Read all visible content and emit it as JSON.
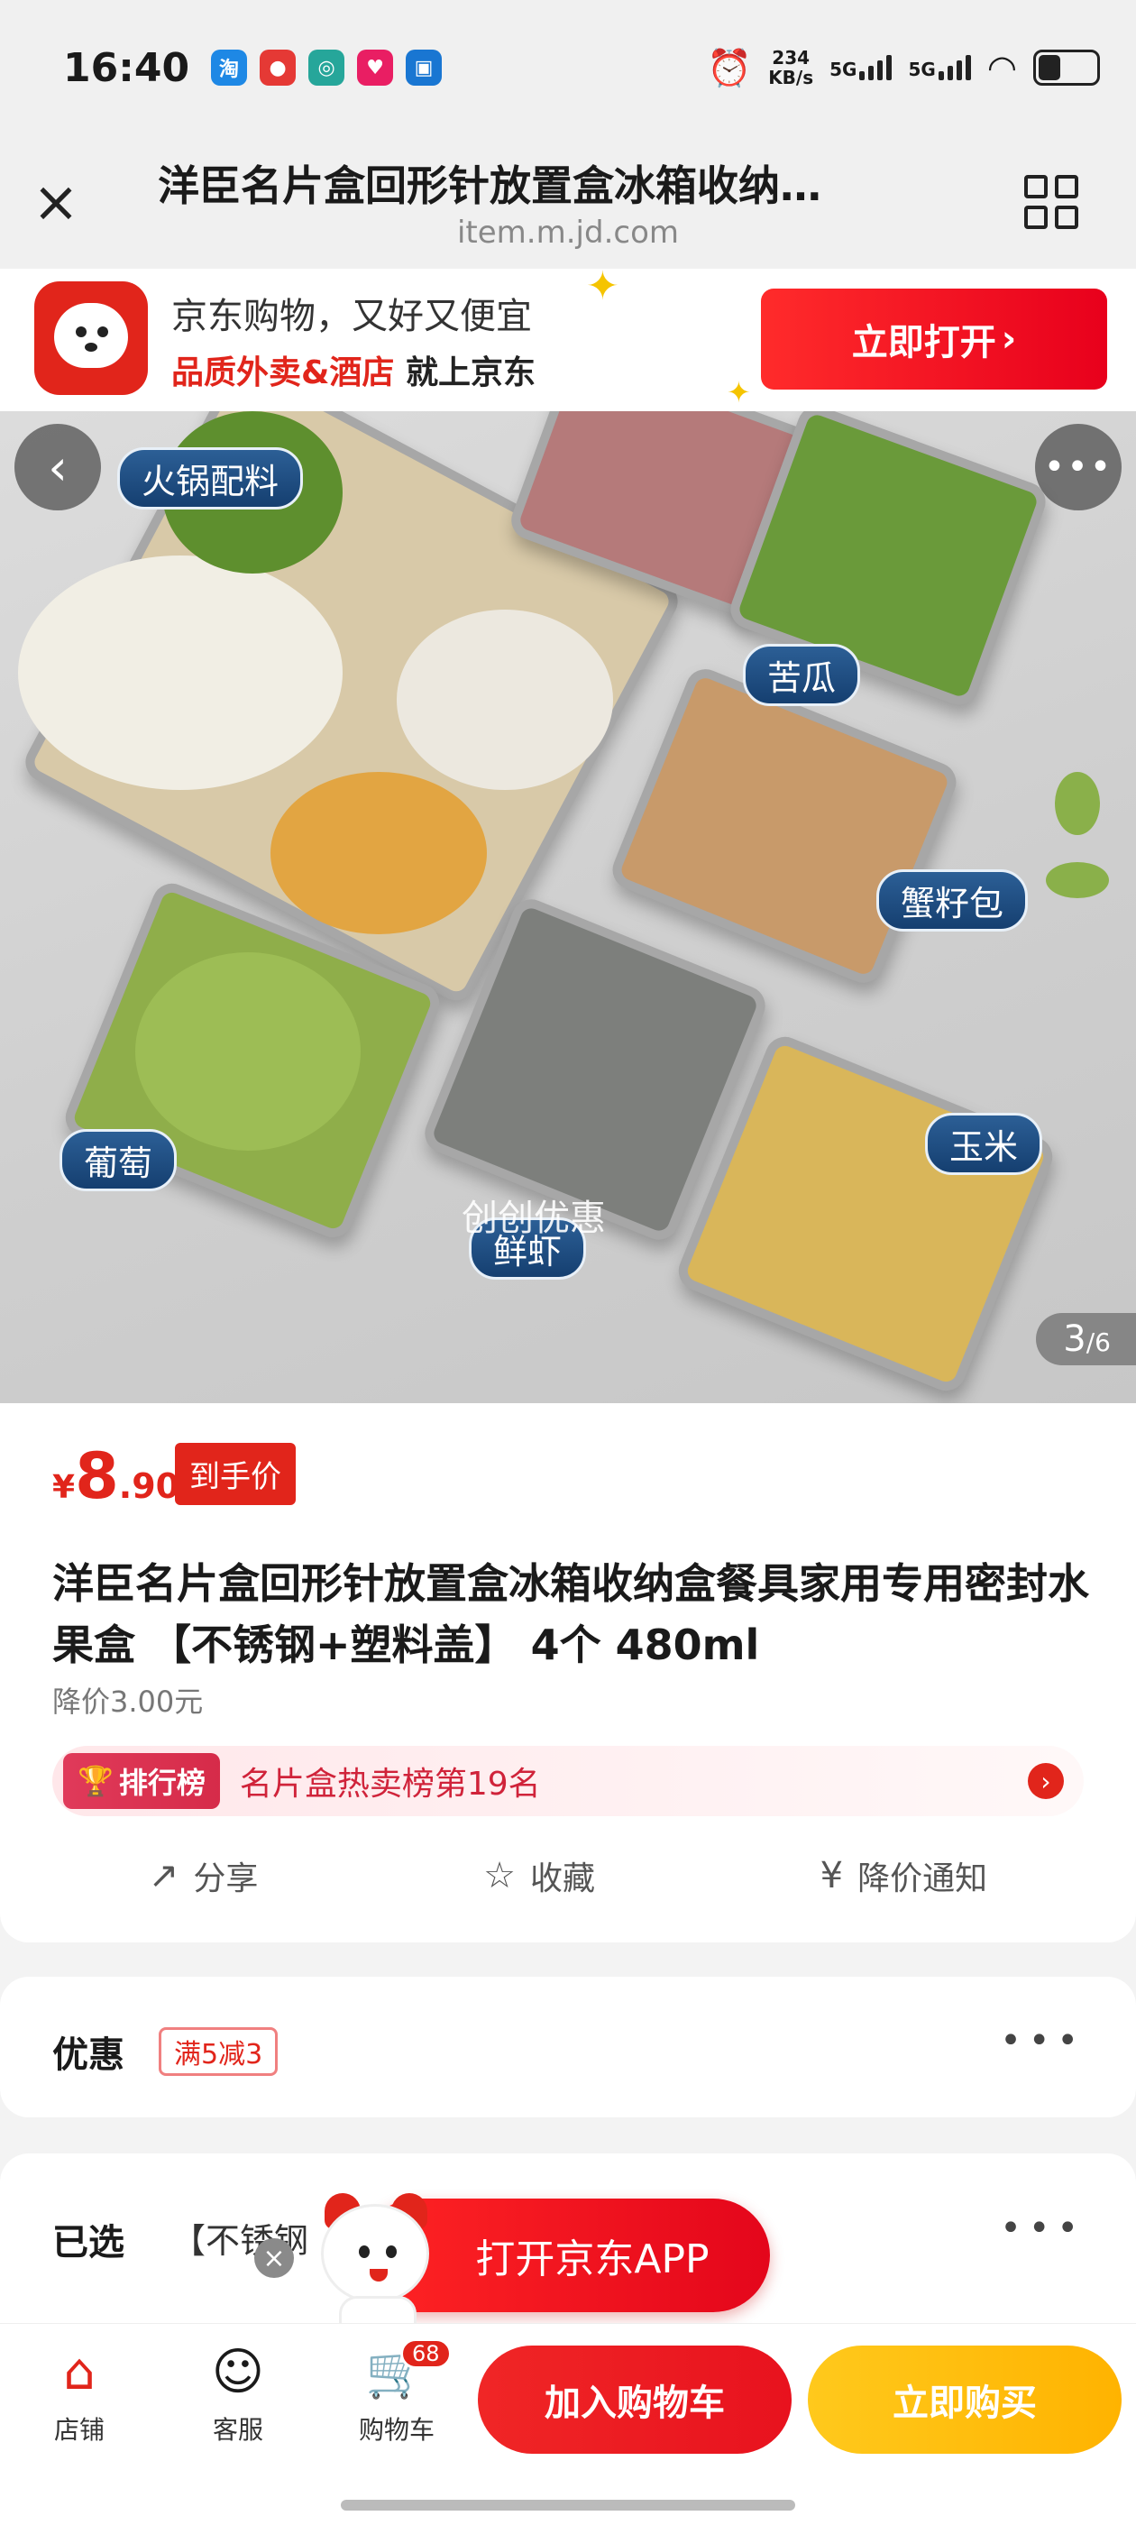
{
  "status_bar": {
    "time": "16:40",
    "net_speed_value": "234",
    "net_speed_unit": "KB/s",
    "signal1": "5G",
    "signal2": "5G"
  },
  "browser": {
    "title": "洋臣名片盒回形针放置盒冰箱收纳…",
    "url": "item.m.jd.com"
  },
  "jd_banner": {
    "line1": "京东购物，又好又便宜",
    "line2_red": "品质外卖&酒店",
    "line2_rest": " 就上京东",
    "open_button": "立即打开"
  },
  "product_image": {
    "labels": {
      "hotpot": "火锅配料",
      "bitter_melon": "苦瓜",
      "crab_bun": "蟹籽包",
      "grape": "葡萄",
      "shrimp": "鲜虾",
      "corn": "玉米"
    },
    "watermark": "创创优惠",
    "counter_current": "3",
    "counter_total": "/6"
  },
  "product": {
    "price_symbol": "¥",
    "price_int": "8",
    "price_dec": ".90",
    "price_tag": "到手价",
    "title": "洋臣名片盒回形针放置盒冰箱收纳盒餐具家用专用密封水果盒 【不锈钢+塑料盖】 4个 480ml",
    "price_drop": "降价3.00元",
    "rank_badge": "排行榜",
    "rank_text": "名片盒热卖榜第19名"
  },
  "actions": {
    "share": "分享",
    "favorite": "收藏",
    "price_alert": "降价通知"
  },
  "promo": {
    "label": "优惠",
    "tag": "满5减3"
  },
  "selected": {
    "label": "已选",
    "value": "【不锈钢"
  },
  "floating": {
    "open_app": "打开京东APP"
  },
  "bottom_bar": {
    "store": "店铺",
    "service": "客服",
    "cart": "购物车",
    "cart_count": "68",
    "add_to_cart": "加入购物车",
    "buy_now": "立即购买"
  }
}
